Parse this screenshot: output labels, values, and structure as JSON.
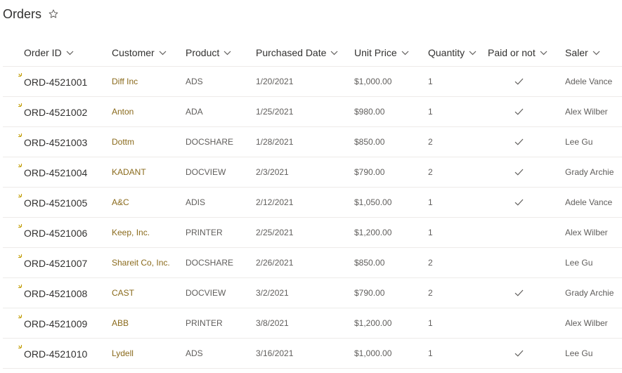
{
  "page": {
    "title": "Orders",
    "favorite_icon": "star-outline-icon"
  },
  "columns": [
    {
      "key": "order_id",
      "label": "Order ID"
    },
    {
      "key": "customer",
      "label": "Customer"
    },
    {
      "key": "product",
      "label": "Product"
    },
    {
      "key": "purchased_date",
      "label": "Purchased Date"
    },
    {
      "key": "unit_price",
      "label": "Unit Price"
    },
    {
      "key": "quantity",
      "label": "Quantity"
    },
    {
      "key": "paid",
      "label": "Paid or not"
    },
    {
      "key": "saler",
      "label": "Saler"
    }
  ],
  "colors": {
    "customer_link": "#8a6a1c",
    "new_indicator": "#c19c00",
    "divider": "#edebe9"
  },
  "rows": [
    {
      "order_id": "ORD-4521001",
      "customer": "Diff Inc",
      "product": "ADS",
      "purchased_date": "1/20/2021",
      "unit_price": "$1,000.00",
      "quantity": "1",
      "paid": true,
      "saler": "Adele Vance"
    },
    {
      "order_id": "ORD-4521002",
      "customer": "Anton",
      "product": "ADA",
      "purchased_date": "1/25/2021",
      "unit_price": "$980.00",
      "quantity": "1",
      "paid": true,
      "saler": "Alex Wilber"
    },
    {
      "order_id": "ORD-4521003",
      "customer": "Dottm",
      "product": "DOCSHARE",
      "purchased_date": "1/28/2021",
      "unit_price": "$850.00",
      "quantity": "2",
      "paid": true,
      "saler": "Lee Gu"
    },
    {
      "order_id": "ORD-4521004",
      "customer": "KADANT",
      "product": "DOCVIEW",
      "purchased_date": "2/3/2021",
      "unit_price": "$790.00",
      "quantity": "2",
      "paid": true,
      "saler": "Grady Archie"
    },
    {
      "order_id": "ORD-4521005",
      "customer": "A&C",
      "product": "ADIS",
      "purchased_date": "2/12/2021",
      "unit_price": "$1,050.00",
      "quantity": "1",
      "paid": true,
      "saler": "Adele Vance"
    },
    {
      "order_id": "ORD-4521006",
      "customer": "Keep, Inc.",
      "product": "PRINTER",
      "purchased_date": "2/25/2021",
      "unit_price": "$1,200.00",
      "quantity": "1",
      "paid": false,
      "saler": "Alex Wilber"
    },
    {
      "order_id": "ORD-4521007",
      "customer": "Shareit Co, Inc.",
      "product": "DOCSHARE",
      "purchased_date": "2/26/2021",
      "unit_price": "$850.00",
      "quantity": "2",
      "paid": false,
      "saler": "Lee Gu"
    },
    {
      "order_id": "ORD-4521008",
      "customer": "CAST",
      "product": "DOCVIEW",
      "purchased_date": "3/2/2021",
      "unit_price": "$790.00",
      "quantity": "2",
      "paid": true,
      "saler": "Grady Archie"
    },
    {
      "order_id": "ORD-4521009",
      "customer": "ABB",
      "product": "PRINTER",
      "purchased_date": "3/8/2021",
      "unit_price": "$1,200.00",
      "quantity": "1",
      "paid": false,
      "saler": "Alex Wilber"
    },
    {
      "order_id": "ORD-4521010",
      "customer": "Lydell",
      "product": "ADS",
      "purchased_date": "3/16/2021",
      "unit_price": "$1,000.00",
      "quantity": "1",
      "paid": true,
      "saler": "Lee Gu"
    }
  ]
}
